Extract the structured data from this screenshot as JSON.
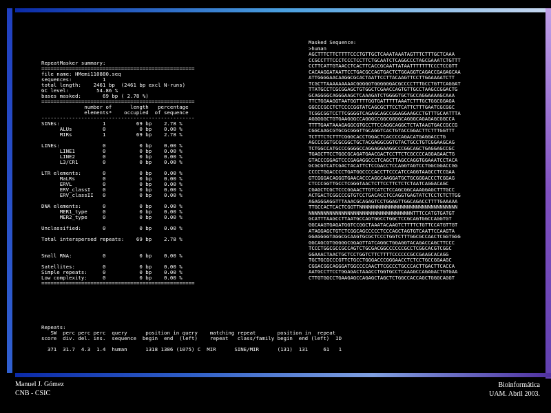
{
  "summary_lines": [
    "RepeatMasker summary:",
    "==================================================",
    "file name: HMemi110880.seq",
    "sequences:          1",
    "total length:    2461 bp  (2461 bp excl N-runs)",
    "GC level:         54.86 %",
    "bases masked:       69 bp ( 2.78 %)",
    "==================================================",
    "              number of      length   percentage",
    "              elements*    occupied  of sequence",
    "--------------------------------------------------",
    "SINEs:              1          69 bp    2.78 %",
    "      ALUs          0           0 bp    0.00 %",
    "      MIRs          1          69 bp    2.78 %",
    "",
    "LINEs:              0           0 bp    0.00 %",
    "      LINE1         0           0 bp    0.00 %",
    "      LINE2         0           0 bp    0.00 %",
    "      L3/CR1        0           0 bp    0.00 %",
    "",
    "LTR elements:       0           0 bp    0.00 %",
    "      MaLRs         0           0 bp    0.00 %",
    "      ERVL          0           0 bp    0.00 %",
    "      ERV_classI    0           0 bp    0.00 %",
    "      ERV_classII   0           0 bp    0.00 %",
    "",
    "DNA elements:       0           0 bp    0.00 %",
    "      MER1_type     0           0 bp    0.00 %",
    "      MER2_type     0           0 bp    0.00 %",
    "",
    "Unclassified:       0           0 bp    0.00 %",
    "",
    "Total interspersed repeats:    69 bp    2.78 %",
    "",
    "",
    "Small RNA:          0           0 bp    0.00 %",
    "",
    "Satellites:         0           0 bp    0.00 %",
    "Simple repeats:     0           0 bp    0.00 %",
    "Low complexity:     0           0 bp    0.00 %",
    "=================================================="
  ],
  "repeats_lines": [
    "Repeats:",
    "   SW  perc perc perc  query      position in query    matching repeat       position in  repeat",
    "score  div. del. ins.  sequence  begin  end  (left)    repeat   class/family begin  end (left)  ID",
    "",
    "  371  31.7  4.3  1.4  human      1318 1386 (1075) C  MIR      SINE/MIR      (131)  131     61   1"
  ],
  "masked_lines": [
    "Masked Sequence:",
    ">human",
    "AGCTTTCTTCTTTTCCCTGTTGCTCAAATAAATAGTTTCTTTGCTCAAA",
    "CCGCCTTTCCCTCCCTCCTTCTGCAATCTCAGGCCCTAGCGAAATCTGTTT",
    "CCTTCATTGTAACCTCACTTCACCGCAATTATAATTTTTTTCCCTCCGTT",
    "CACAAGGATAATTCCTGACGCCAGTGACTCTGGAGGTCAGACCGAGAGCAA",
    "ATTGGGGAACAAGGCGCACTAATTCCTTACAAGTTCCTTGAAAAATCTT",
    "TCGCTTAAAAAAAAACGGGGGTGGGGGGACGCCCCTTTGCCTGTTCAGGAT",
    "TTATGCCTCGCGGAGCTGTGGCTCGAACCAGTGTTGCCTAAGCCGGACTG",
    "GCAGGGGCAGGGAAGCTCAAAGATCTGGGGTGCTGCCAGGAAAAGCAAA",
    "TTCTGGAAGGTAATGGTTTTGGTGATTTTTAAATCTTTGCTGGCGGAGA",
    "GGCCCGCCTCTCCCCGGTATCAGCGCTTCCTCATTCTTTGAATCGCGGC",
    "TCGGCGGTCCTTCGGGGTCAGAGCAGCCGGAGGAAGCCTGTTTGCAATTTA",
    "AGGGGGCTGTGAAGGGCCAGGGCCGGCGGGGCAGGGCAGAGAGCGGCCA",
    "TTTTGAATAAAGAGGCGTGCCTTCCAGGCAGGCTCTATAAGTGACCGCCG",
    "CGGCAAGCGTGCGCGGGTTGCAGGTCACTGTACCGGACTTCTTTGGTTT",
    "TCTTTCTCTTTCGGGCACCTGGACTCACCCCAGACATGAGGACCTG",
    "AGCCCGGTGCGCGGCTGCTACGAGGCGGTGTACTGCCTGTCGGAAGCAG",
    "TCTGGCCATGCCCGGGGCCAGGAGGAAGGCCCGGCAGCTGAGGAGCCGC",
    "TGAGCTTCCTGGCGCAGATGAACGACTCCTTCTCGCCCCAGGAGAACTG",
    "GTACCCGGAGTCCCGAGAGGCCCTCAGCTTAGCCAGGTGGAAATCCTACA",
    "GCGCGTCATCGACTACATTCTCCGACCTCCAGGTAGTCCTGGCGGACCGG",
    "CCCCTGGACCCCTGATGGCCCCACCTTCCCATCCAGGTAAGCCTCCGAA",
    "GTCGGGACAGGGTGAACACCCAGGCAAGGATGCTGCGGGACCCTCGGAG",
    "CTCCCGGTTGCCTCGGGTAACTCTTCCTTCTCTCTAATCAGGACAGC",
    "CGAGCTCGCTCCCGGAACTTGTCATCTCCAGCGGCAAAGGAGCTTTGCC",
    "ACTGACTCGGCCCGTGTCCTGACACCTCCAGGTGAGTATCTCCTCTCTTGG",
    "AGAGGGAGGTTTAAACGCAGAGTCCTGGAGTTGGCAGACCTTTTGAAAAA",
    "TTGCCACTCACTCGGTTNNNNNNNNNNNNNNNNNNNNNNNNNNNNNNNNN",
    "NNNNNNNNNNNNNNNNNNNNNNNNNNNNNNNNNNNTTTCCATGTGATGT",
    "GCATTTAAGCCTTAATGCCAGTGGCCTGGCTCCGCAGTGGCCAGGTGT",
    "GGCAAGTGAGATGGTCCGGCTAAATACAAGTCTTTTCTGTTCCATGTTGT",
    "ATAGGAGCTGTCTCGGCAGCCCCCTCCCAGCTAGTGTCAATTCCAAGTA",
    "GGAGGGGTAGGCGCAAGTGCGCTCCCTGGTCTTTGGCGCCAACTCGGTGGG",
    "GGCAGCGTGGGGGCGGAGTTATCAGGCTGGAGGTACAGACCAGCTTCCC",
    "TCCCTGGCGCCGCCAGTCTGCGACGGCCCCCCGCCTCGGCACGTCGGC",
    "GGAAACTAACTGCTCCTGGTCTTCTTTTCCCCCCGCCGAAGCACAGG",
    "TGCTGCGCCCGTTCTGCCTGGGACCCGGGAACCTCTCCTGCCGGAAGC",
    "CGGACGGCAGGGATGGCCCCAACTTCGCCCTGCCCACTTGACTTCACCA",
    "AATGCCTTCCTGGAGACTAAACCTGGTGCCTCAAAGCCAGAGACTGTGAA",
    "CTTGTGGCCTGAAGAGCCAGAGCTAGCTCTGGCCACCAGCTGGGCAGGT"
  ],
  "footer": {
    "left_line1": "Manuel J. Gómez",
    "left_line2": "CNB - CSIC",
    "right_line1": "Bioinformática",
    "right_line2": "UAM. Abril 2003."
  },
  "colors": {
    "background": "#000000",
    "text": "#ffffff",
    "frame_blue": "#2040c0",
    "frame_purple": "#8050c0"
  }
}
